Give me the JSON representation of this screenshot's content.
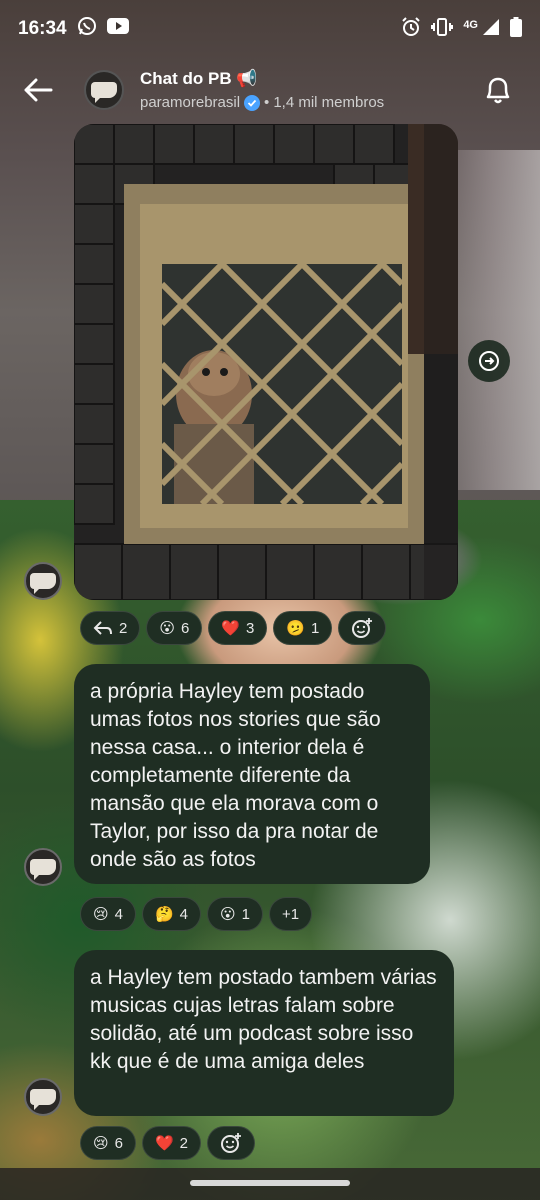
{
  "status_bar": {
    "time": "16:34",
    "network": "4G"
  },
  "header": {
    "title": "Chat do PB 📢",
    "channel": "paramorebrasil",
    "separator": "•",
    "members": "1,4 mil membros"
  },
  "messages": [
    {
      "type": "image",
      "reactions": [
        {
          "icon": "reply-icon",
          "emoji": "↩",
          "count": "2"
        },
        {
          "emoji": "😮",
          "count": "6"
        },
        {
          "emoji": "❤️",
          "count": "3"
        },
        {
          "emoji": "🫤",
          "count": "1"
        }
      ]
    },
    {
      "type": "text",
      "text": "a própria Hayley tem postado umas fotos nos stories que são nessa casa... o interior dela é completamente diferente da mansão que ela morava com o Taylor, por isso da pra notar de onde são as fotos",
      "reactions": [
        {
          "emoji": "😢",
          "count": "4"
        },
        {
          "emoji": "🤔",
          "count": "4"
        },
        {
          "emoji": "😮",
          "count": "1"
        },
        {
          "emoji": "",
          "count": "+1"
        }
      ]
    },
    {
      "type": "text",
      "text": "a Hayley tem postado tambem várias musicas cujas letras falam sobre solidão, até um podcast sobre isso kk que é de uma amiga deles",
      "reactions": [
        {
          "emoji": "😢",
          "count": "6"
        },
        {
          "emoji": "❤️",
          "count": "2"
        }
      ]
    }
  ],
  "colors": {
    "bubble": "#1f2e23",
    "verified": "#4aa3ff"
  }
}
